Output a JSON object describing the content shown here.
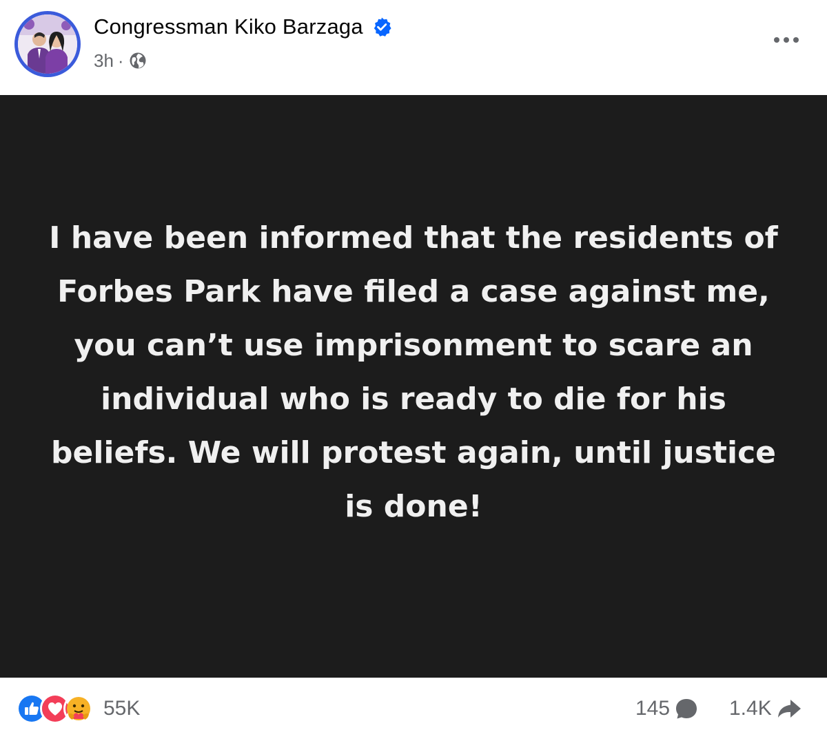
{
  "post": {
    "author": "Congressman Kiko Barzaga",
    "verified": true,
    "time": "3h",
    "separator": "·",
    "audience_icon": "globe-icon",
    "more_icon": "more-options-icon",
    "text": "I have been informed that the residents of Forbes Park have filed a case against me, you can’t use imprisonment to scare an individual who is ready to die for his beliefs. We will protest again, until justice is done!",
    "background_color": "#1c1c1c",
    "text_color": "#f0f0f0"
  },
  "footer": {
    "reactions": [
      "like-reaction-icon",
      "love-reaction-icon",
      "care-reaction-icon"
    ],
    "reaction_count": "55K",
    "comment_count": "145",
    "comment_icon": "comment-icon",
    "share_count": "1.4K",
    "share_icon": "share-icon"
  },
  "colors": {
    "verified_blue": "#0866ff",
    "like_blue": "#1877f2",
    "love_red": "#f33e58",
    "care_yellow": "#f7b125",
    "meta_gray": "#65676b"
  }
}
